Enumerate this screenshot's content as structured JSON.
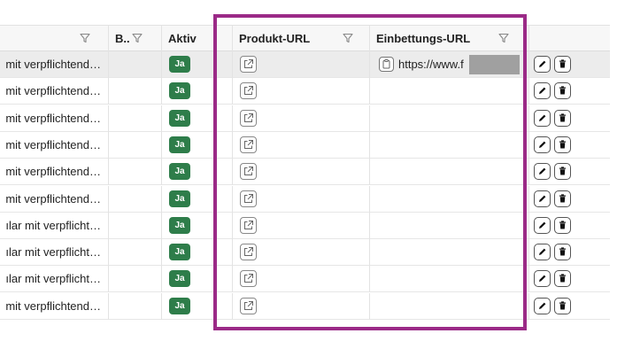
{
  "columns": {
    "bezeichnung_filter": "filter-icon",
    "b": "B..",
    "aktiv": "Aktiv",
    "produkt_url": "Produkt-URL",
    "einbettungs_url": "Einbettungs-URL"
  },
  "rows": [
    {
      "name": "mit verpflichtend…",
      "aktiv": "Ja",
      "embed": "https://www.f"
    },
    {
      "name": "mit verpflichtend…",
      "aktiv": "Ja"
    },
    {
      "name": "mit verpflichtend…",
      "aktiv": "Ja"
    },
    {
      "name": "mit verpflichtend…",
      "aktiv": "Ja"
    },
    {
      "name": "mit verpflichtend…",
      "aktiv": "Ja"
    },
    {
      "name": "mit verpflichtend…",
      "aktiv": "Ja"
    },
    {
      "name": "ılar mit verpflicht…",
      "aktiv": "Ja"
    },
    {
      "name": "ılar mit verpflicht…",
      "aktiv": "Ja"
    },
    {
      "name": "ılar mit verpflicht…",
      "aktiv": "Ja"
    },
    {
      "name": "mit verpflichtend…",
      "aktiv": "Ja"
    }
  ],
  "colors": {
    "highlight": "#9b2a87",
    "badge": "#2e7d4a"
  }
}
